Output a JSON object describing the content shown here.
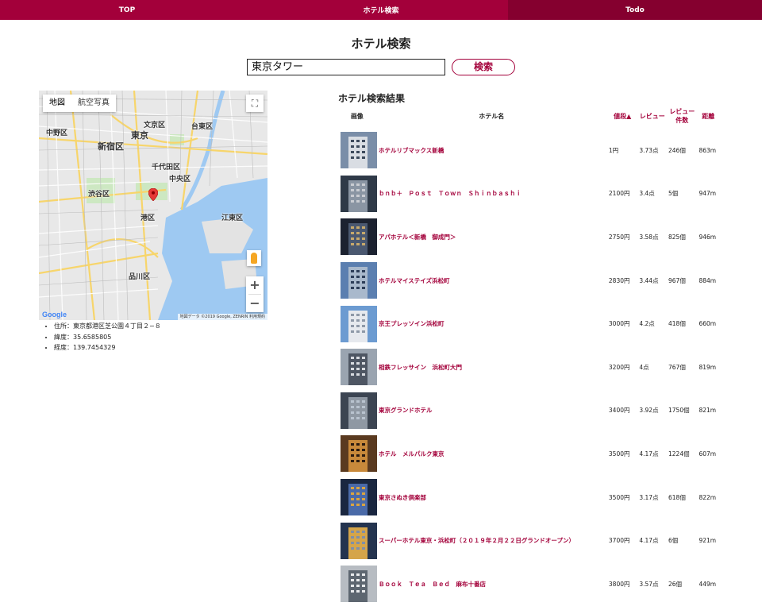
{
  "nav": {
    "items": [
      {
        "label": "TOP"
      },
      {
        "label": "ホテル検索"
      },
      {
        "label": "Todo"
      }
    ]
  },
  "page_title": "ホテル検索",
  "search": {
    "value": "東京タワー",
    "button_label": "検索"
  },
  "map": {
    "type_buttons": [
      "地図",
      "航空写真"
    ],
    "fullscreen_icon": "fullscreen-icon",
    "zoom_in": "+",
    "zoom_out": "−",
    "attribution": "地図データ ©2019 Google, ZENRIN   利用規約",
    "logo": "Google",
    "labels": [
      {
        "text": "文京区"
      },
      {
        "text": "中野区"
      },
      {
        "text": "台東区"
      },
      {
        "text": "新宿区"
      },
      {
        "text": "東京"
      },
      {
        "text": "千代田区"
      },
      {
        "text": "中央区"
      },
      {
        "text": "渋谷区"
      },
      {
        "text": "港区"
      },
      {
        "text": "江東区"
      },
      {
        "text": "品川区"
      }
    ]
  },
  "info": {
    "address": "住所：東京都港区芝公園４丁目２−８",
    "latitude": "緯度：35.6585805",
    "longitude": "経度：139.7454329"
  },
  "results": {
    "title": "ホテル検索結果",
    "headers": {
      "image": "画像",
      "name": "ホテル名",
      "price": "値段▲",
      "review": "レビュー",
      "review_count_1": "レビュー",
      "review_count_2": "件数",
      "distance": "距離"
    },
    "rows": [
      {
        "name": "ホテルリブマックス新橋",
        "price": "1円",
        "review": "3.73点",
        "count": "246個",
        "distance": "863m"
      },
      {
        "name": "ｂｎｂ＋　Ｐｏｓｔ　Ｔｏｗｎ　Ｓｈｉｎｂａｓｈｉ",
        "price": "2100円",
        "review": "3.4点",
        "count": "5個",
        "distance": "947m"
      },
      {
        "name": "アパホテル＜新橋　御成門＞",
        "price": "2750円",
        "review": "3.58点",
        "count": "825個",
        "distance": "946m"
      },
      {
        "name": "ホテルマイステイズ浜松町",
        "price": "2830円",
        "review": "3.44点",
        "count": "967個",
        "distance": "884m"
      },
      {
        "name": "京王プレッソイン浜松町",
        "price": "3000円",
        "review": "4.2点",
        "count": "418個",
        "distance": "660m"
      },
      {
        "name": "相鉄フレッサイン　浜松町大門",
        "price": "3200円",
        "review": "4点",
        "count": "767個",
        "distance": "819m"
      },
      {
        "name": "東京グランドホテル",
        "price": "3400円",
        "review": "3.92点",
        "count": "1750個",
        "distance": "821m"
      },
      {
        "name": "ホテル　メルパルク東京",
        "price": "3500円",
        "review": "4.17点",
        "count": "1224個",
        "distance": "607m"
      },
      {
        "name": "東京さぬき倶楽部",
        "price": "3500円",
        "review": "3.17点",
        "count": "618個",
        "distance": "822m"
      },
      {
        "name": "スーパーホテル東京・浜松町（２０１９年２月２２日グランドオープン）",
        "price": "3700円",
        "review": "4.17点",
        "count": "6個",
        "distance": "921m"
      },
      {
        "name": "Ｂｏｏｋ　Ｔｅａ　Ｂｅｄ　麻布十番店",
        "price": "3800円",
        "review": "3.57点",
        "count": "26個",
        "distance": "449m"
      }
    ]
  },
  "colors": {
    "accent": "#a3003a",
    "nav_active": "#85002f"
  }
}
